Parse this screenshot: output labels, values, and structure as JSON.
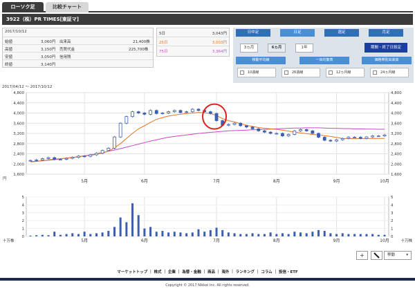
{
  "tabs": {
    "candle": "ローソク足",
    "compare": "比較チャート"
  },
  "header": {
    "title": "3922（株）PR TIMES[東証マ]"
  },
  "stats": {
    "date": "2017/10/12",
    "open_label": "始値",
    "open": "3,060円",
    "volume_label": "出来高",
    "volume": "21,400株",
    "high_label": "高値",
    "high": "3,150円",
    "value_label": "売買代金",
    "value": "225,700株",
    "low_label": "安値",
    "low": "3,050円",
    "margin_label": "信用残",
    "margin": "",
    "close_label": "終値",
    "close": "3,140円"
  },
  "ma": {
    "d5_label": "5日",
    "d5": "3,043円",
    "d25_label": "25日",
    "d25": "3,003円",
    "d75_label": "75日",
    "d75": "3,364円"
  },
  "controls": {
    "period_tabs": [
      "日中足",
      "日足",
      "週足",
      "月足"
    ],
    "period_selected": 1,
    "ranges": [
      "3ヵ月",
      "6ヵ月",
      "1年"
    ],
    "range_selected": 1,
    "set_button": "期間・終了日設定",
    "trend_buttons": [
      "移動平均線",
      "一目均衡表",
      "価格帯別出来高"
    ],
    "checks": [
      "10週線",
      "26週線",
      "12ヵ月線",
      "24ヵ月線"
    ]
  },
  "range_text": "2017/04/12 〜 2017/10/12",
  "colors": {
    "ma_short": "#e8731f",
    "ma_long": "#c548c5",
    "candle": "#3a5fb0",
    "highlight": "#e0201b",
    "volume": "#3a5fb0"
  },
  "toolbar": {
    "plus": "+",
    "mode": "移動",
    "pen_icon": "pen-icon"
  },
  "footer": {
    "links": "マーケットトップ ｜ 株式 ｜ 企業 ｜ 為替・金融 ｜ 商品 ｜ 海外 ｜ ランキング ｜ コラム ｜ 投信・ETF",
    "copyright": "Copyright © 2017 Nikkei Inc. All rights reserved."
  },
  "chart_data": {
    "type": "candlestick",
    "x_range": [
      "2017-04-12",
      "2017-10-12"
    ],
    "x_ticks": [
      "5月",
      "6月",
      "7月",
      "8月",
      "9月",
      "10月"
    ],
    "y_ticks": [
      1600,
      2000,
      2400,
      2800,
      3200,
      3600,
      4000,
      4400,
      4800
    ],
    "y_tick_labels": [
      "1,600",
      "2,000",
      "2,400",
      "2,800",
      "3,200",
      "3,600",
      "4,000",
      "4,400",
      "4,800"
    ],
    "y_unit": "円",
    "ylim": [
      1600,
      4800
    ],
    "close_series": [
      2140,
      2160,
      2210,
      2250,
      2180,
      2180,
      2220,
      2260,
      2310,
      2300,
      2360,
      2420,
      2530,
      2620,
      3060,
      3600,
      3860,
      4050,
      4000,
      3950,
      4100,
      3980,
      4000,
      4050,
      4100,
      4020,
      4050,
      4150,
      4100,
      4050,
      3980,
      3700,
      3520,
      3550,
      3600,
      3500,
      3450,
      3380,
      3300,
      3250,
      3200,
      3200,
      3100,
      3160,
      3300,
      3350,
      3300,
      3200,
      3050,
      2930,
      2900,
      2950,
      3000,
      3050,
      3050,
      3000,
      3060,
      3100,
      3100,
      3140
    ],
    "ma_short_series": [
      2080,
      2100,
      2130,
      2160,
      2190,
      2210,
      2230,
      2250,
      2280,
      2310,
      2340,
      2380,
      2430,
      2500,
      2640,
      2800,
      3000,
      3200,
      3380,
      3500,
      3630,
      3750,
      3820,
      3880,
      3920,
      3950,
      3980,
      4000,
      4020,
      4010,
      3980,
      3900,
      3780,
      3700,
      3650,
      3580,
      3520,
      3470,
      3430,
      3400,
      3380,
      3360,
      3330,
      3290,
      3250,
      3220,
      3190,
      3160,
      3140,
      3110,
      3080,
      3040,
      3000,
      3000,
      2990,
      3000,
      3000,
      3000,
      3003,
      3003
    ],
    "ma_long_series": [
      2100,
      2110,
      2130,
      2150,
      2170,
      2200,
      2230,
      2260,
      2290,
      2320,
      2360,
      2400,
      2450,
      2500,
      2550,
      2600,
      2660,
      2720,
      2780,
      2840,
      2900,
      2950,
      3000,
      3050,
      3080,
      3110,
      3140,
      3170,
      3200,
      3220,
      3240,
      3260,
      3280,
      3300,
      3310,
      3320,
      3330,
      3340,
      3350,
      3360,
      3370,
      3380,
      3390,
      3400,
      3410,
      3410,
      3420,
      3420,
      3420,
      3410,
      3400,
      3400,
      3390,
      3390,
      3380,
      3380,
      3370,
      3370,
      3364,
      3364
    ],
    "volume": {
      "unit": "十万株",
      "y_ticks": [
        0,
        1,
        2,
        3,
        4,
        5
      ],
      "ylim": [
        0,
        5
      ],
      "values": [
        0.1,
        0.15,
        0.2,
        0.15,
        0.6,
        0.2,
        0.3,
        0.4,
        0.3,
        0.6,
        0.3,
        0.4,
        0.5,
        0.7,
        1.2,
        2.4,
        1.8,
        4.2,
        2.7,
        1.0,
        1.2,
        0.6,
        0.7,
        0.5,
        0.6,
        0.5,
        0.4,
        0.5,
        0.9,
        0.6,
        0.8,
        1.1,
        0.8,
        0.5,
        0.4,
        0.3,
        0.3,
        0.4,
        0.3,
        0.3,
        0.5,
        0.3,
        0.4,
        0.3,
        0.6,
        0.5,
        0.4,
        0.6,
        0.8,
        0.7,
        0.4,
        0.3,
        0.4,
        0.3,
        0.3,
        0.3,
        0.3,
        0.3,
        0.2,
        0.2
      ]
    },
    "highlight_index": 31
  }
}
